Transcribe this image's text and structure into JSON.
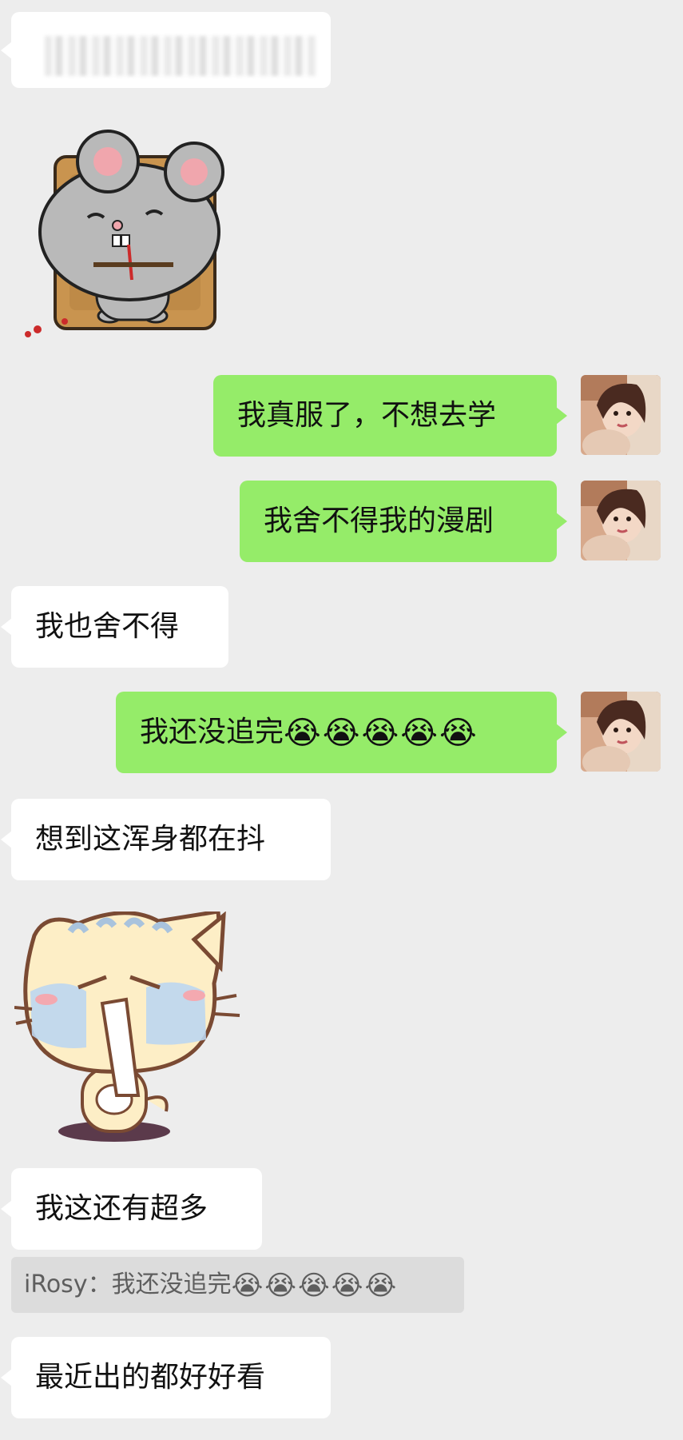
{
  "colors": {
    "chat_background": "#ededed",
    "incoming_bubble": "#ffffff",
    "outgoing_bubble": "#95ec69",
    "quote_background": "#dcdcdc"
  },
  "messages": {
    "m1_blurred": "",
    "m2_sticker": "mouse-trap-sticker",
    "m3_text": "我真服了，不想去学",
    "m4_text": "我舍不得我的漫剧",
    "m5_text": "我也舍不得",
    "m6_text": "我还没追完",
    "m6_emojis": "😭😭😭😭😭",
    "m7_text": "想到这浑身都在抖",
    "m8_sticker": "crying-cat-sticker",
    "m9_text": "我这还有超多",
    "m9_quote_prefix": "iRosy：我还没追完",
    "m9_quote_emojis": "😭😭😭😭😭",
    "m10_text": "最近出的都好好看"
  }
}
